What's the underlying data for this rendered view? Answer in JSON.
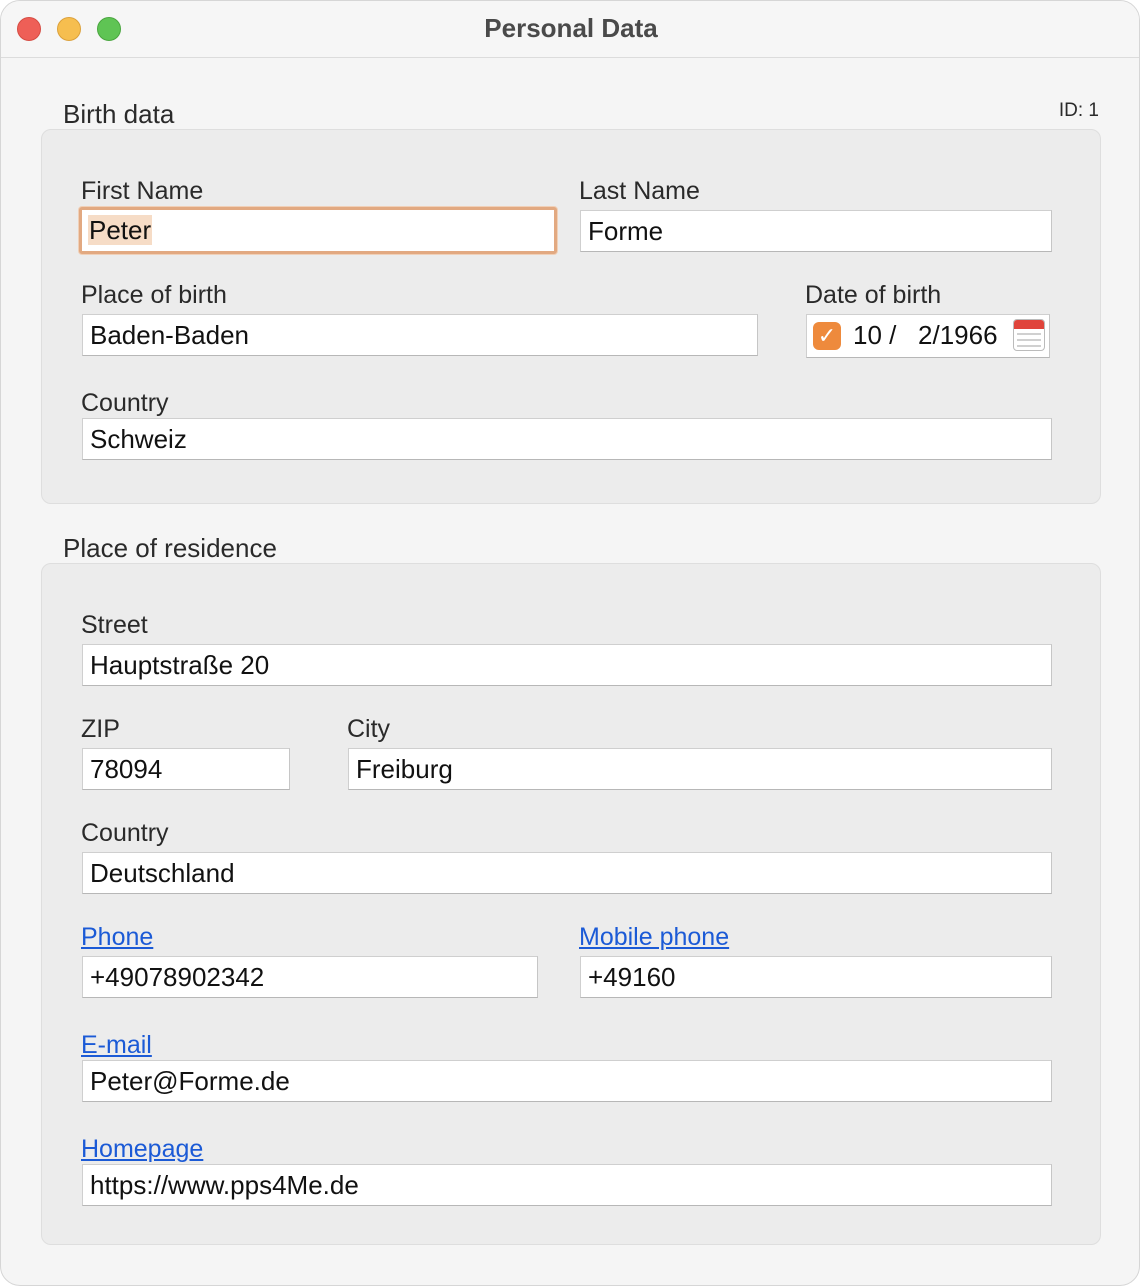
{
  "window": {
    "title": "Personal Data"
  },
  "record": {
    "id_label": "ID: 1"
  },
  "birth": {
    "group_title": "Birth data",
    "first_name_label": "First Name",
    "first_name_value": "Peter",
    "last_name_label": "Last Name",
    "last_name_value": "Forme",
    "place_label": "Place of birth",
    "place_value": "Baden-Baden",
    "date_label": "Date of birth",
    "date_value": "10 /   2/1966",
    "date_enabled": true,
    "country_label": "Country",
    "country_value": "Schweiz"
  },
  "residence": {
    "group_title": "Place of residence",
    "street_label": "Street",
    "street_value": "Hauptstraße 20",
    "zip_label": "ZIP",
    "zip_value": "78094",
    "city_label": "City",
    "city_value": "Freiburg",
    "country_label": "Country",
    "country_value": "Deutschland",
    "phone_label": "Phone",
    "phone_value": "+49078902342",
    "mobile_label": "Mobile phone",
    "mobile_value": "+49160",
    "email_label": "E-mail",
    "email_value": "Peter@Forme.de",
    "homepage_label": "Homepage",
    "homepage_value": "https://www.pps4Me.de"
  },
  "colors": {
    "focus_ring": "#e2a981",
    "checkbox": "#ee8a3c",
    "link": "#1b5ad6",
    "close": "#ee5f57",
    "minimize": "#f6be4f",
    "maximize": "#5fc454"
  }
}
